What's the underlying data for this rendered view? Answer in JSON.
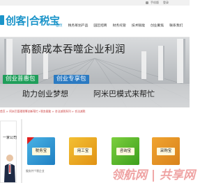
{
  "topbar": {
    "link1": "手机版",
    "link2": "登录"
  },
  "logo": {
    "text": "创客|合税宝"
  },
  "nav": {
    "items": [
      "首页",
      "税务筹划产品",
      "园区招商",
      "财务托管",
      "技术赋能",
      "创业聚焦",
      "联系我们"
    ]
  },
  "banner": {
    "headline": "高额成本吞噬企业利润",
    "pill1": "创业普惠包",
    "pill2": "创业专享包",
    "slogan1": "助力创业梦想",
    "slogan2": "阿米巴模式来帮忙"
  },
  "notice": {
    "text": "首页 > 阿米巴管理税筹创新帮忙+税务赋能 > 合法减税系列 > 合法减税"
  },
  "card_left": {
    "title": "一家公司"
  },
  "tiles": [
    {
      "label": "税务宝"
    },
    {
      "label": "用工宝"
    },
    {
      "label": "咨询宝"
    },
    {
      "label": "采购宝"
    }
  ],
  "small_text": "服务并个税企业",
  "watermark": "领航网 | 共享网",
  "colors": {
    "brand": "#1b94c9",
    "green_pill": "#1f9e5a",
    "blue_pill": "#2b7ac2"
  }
}
